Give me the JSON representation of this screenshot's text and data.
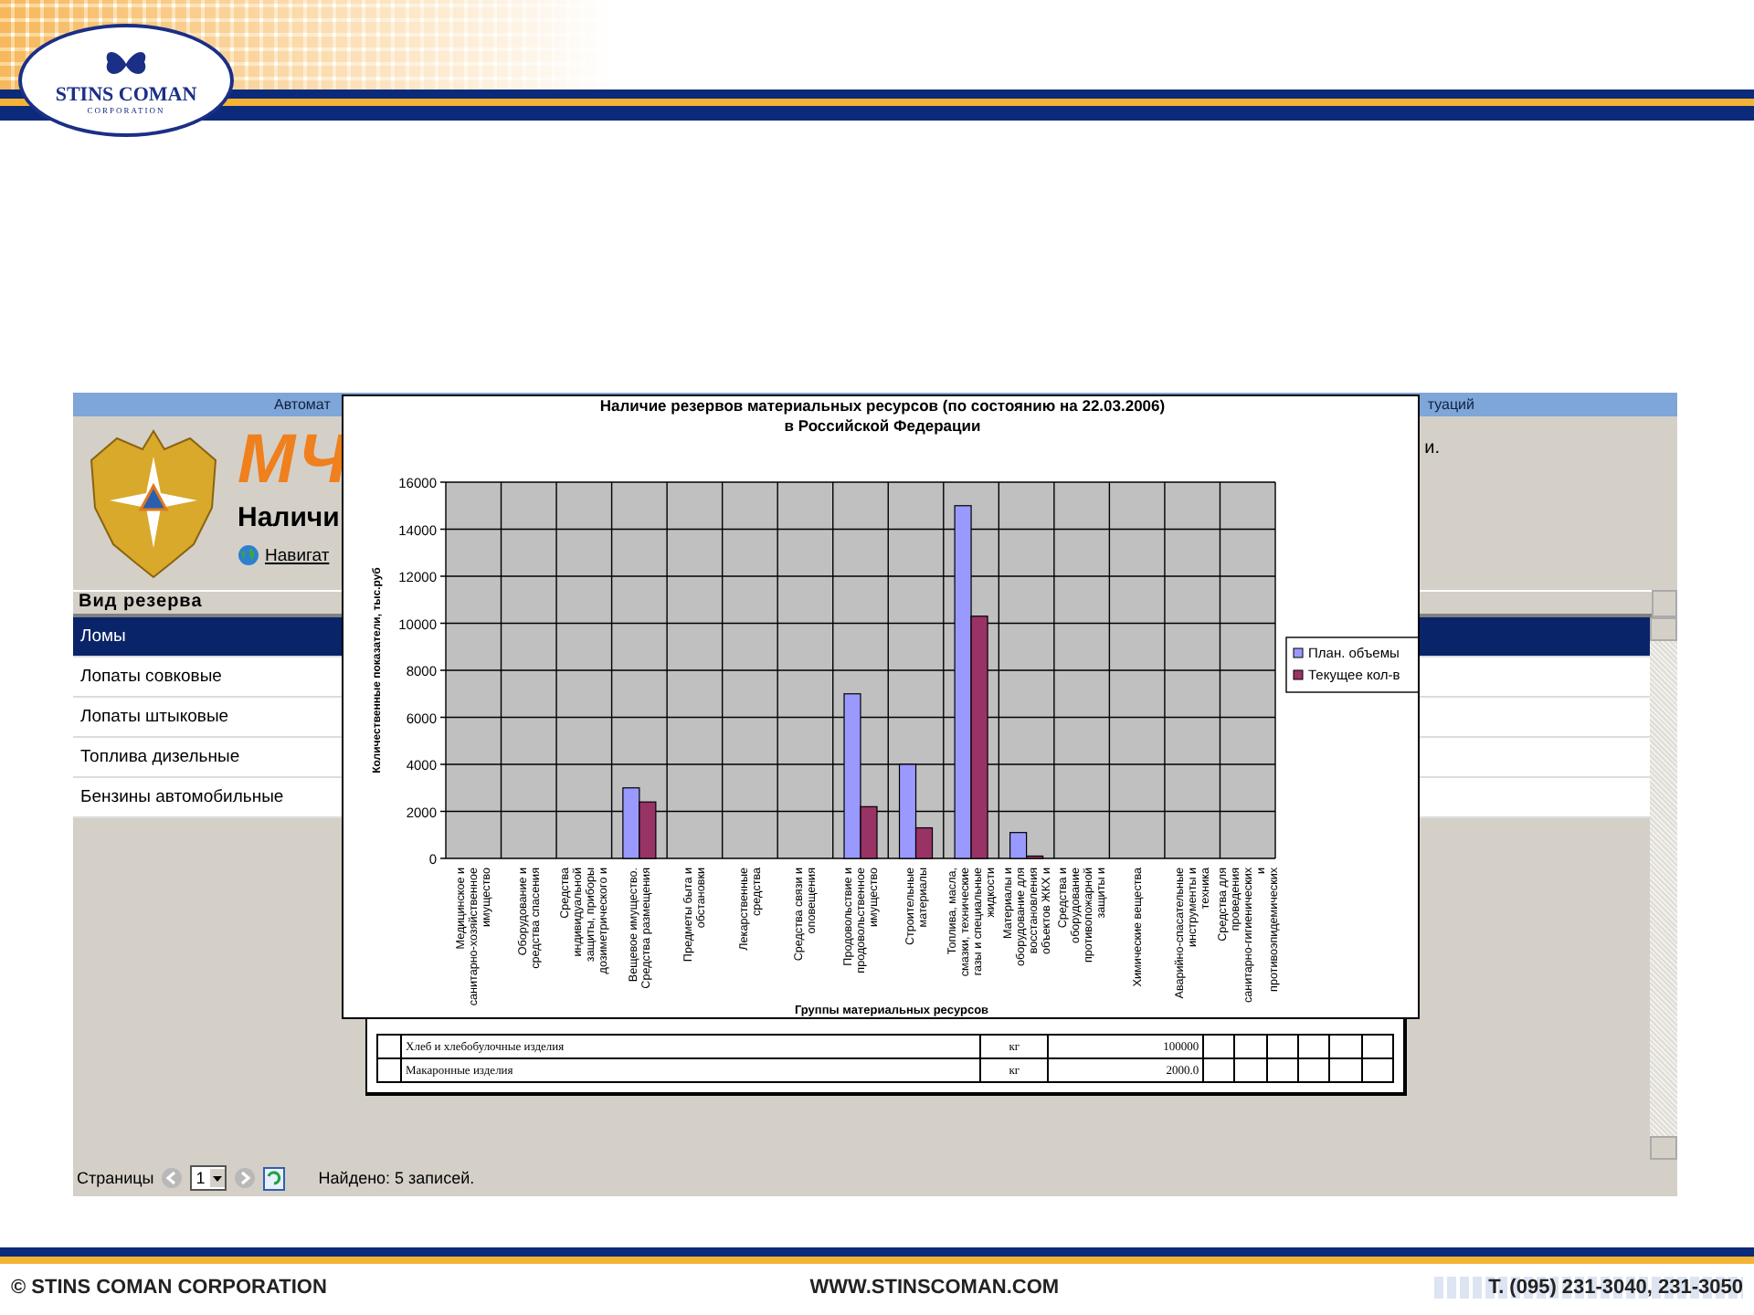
{
  "slide_header": {
    "logo_name": "STINS COMAN",
    "logo_sub": "CORPORATION"
  },
  "app": {
    "top_bar_left": "Автомат",
    "top_bar_right": "туаций",
    "brand": "МЧ",
    "page_title": "Наличи",
    "nav_link": "Навигат",
    "header_tail": "и.",
    "list_header": "Вид резерва",
    "items": [
      {
        "label": "Ломы",
        "selected": true
      },
      {
        "label": "Лопаты совковые",
        "selected": false
      },
      {
        "label": "Лопаты штыковые",
        "selected": false
      },
      {
        "label": "Топлива дизельные",
        "selected": false
      },
      {
        "label": "Бензины автомобильные",
        "selected": false
      }
    ],
    "pager": {
      "label": "Страницы",
      "page": "1",
      "found": "Найдено: 5 записей."
    }
  },
  "table": {
    "rows": [
      [
        "Хлеб и хлебобулочные изделия",
        "кг",
        "100000"
      ],
      [
        "Макаронные изделия",
        "кг",
        "2000.0"
      ]
    ]
  },
  "chart_window": {
    "chart_data": {
      "type": "bar",
      "title": "Наличие резервов материальных ресурсов (по состоянию на 22.03.2006)\nв Российской Федерации",
      "xlabel": "Группы материальных ресурсов",
      "ylabel": "Количественные показатели, тыс.руб",
      "categories": [
        "Медицинское и санитарно-хозяйственное имущество",
        "Оборудование и средства спасения",
        "Средства индивидуальной защиты, приборы дозиметрического и",
        "Вещевое имущество. Средства размещения",
        "Предметы быта и обстановки",
        "Лекарственные средства",
        "Средства связи и оповещения",
        "Продовольствие и продовольственное имущество",
        "Строительные материалы",
        "Топлива, масла, смазки, технические газы и специальные жидкости",
        "Материалы и оборудование для восстановления объектов ЖКХ и",
        "Средства и оборудование противопожарной защиты и",
        "Химические вещества",
        "Аварийно-спасательные инструменты и техника",
        "Средства для проведения санитарно-гигиенических и противоэпидемических"
      ],
      "series": [
        {
          "name": "План. объемы",
          "color": "#9999ff",
          "values": [
            0,
            0,
            0,
            3000,
            0,
            0,
            0,
            7000,
            4000,
            15000,
            1100,
            0,
            0,
            0,
            0
          ]
        },
        {
          "name": "Текущее кол-в",
          "color": "#993366",
          "values": [
            0,
            0,
            0,
            2400,
            0,
            0,
            0,
            2200,
            1300,
            10300,
            100,
            0,
            0,
            0,
            0
          ]
        }
      ],
      "grid": true,
      "legend": true,
      "ylim": [
        0,
        16000
      ],
      "yticks": [
        0,
        2000,
        4000,
        6000,
        8000,
        10000,
        12000,
        14000,
        16000
      ]
    }
  },
  "footer": {
    "copyright": "© STINS COMAN CORPORATION",
    "site": "WWW.STINSCOMAN.COM",
    "phone": "T. (095) 231-3040, 231-3050"
  }
}
